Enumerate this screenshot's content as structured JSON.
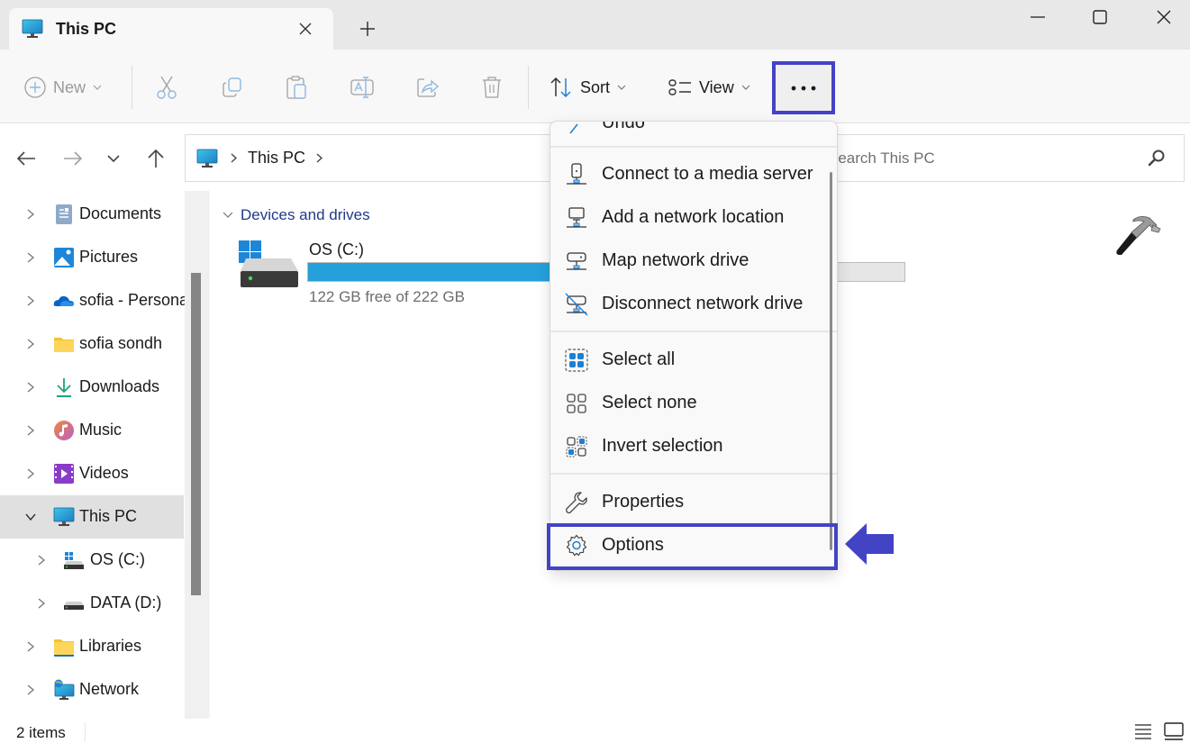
{
  "window": {
    "tab_title": "This PC",
    "controls": {
      "minimize": "minimize",
      "maximize": "maximize",
      "close": "close"
    }
  },
  "toolbar": {
    "new_label": "New",
    "sort_label": "Sort",
    "view_label": "View",
    "more_label": "See more",
    "icons": [
      "cut-icon",
      "copy-icon",
      "paste-icon",
      "rename-icon",
      "share-icon",
      "delete-icon"
    ]
  },
  "nav": {
    "breadcrumb": [
      "This PC"
    ],
    "search_placeholder": "Search This PC"
  },
  "sidebar": {
    "items": [
      {
        "label": "Documents",
        "icon": "documents-icon"
      },
      {
        "label": "Pictures",
        "icon": "pictures-icon"
      },
      {
        "label": "sofia - Persona",
        "icon": "onedrive-icon"
      },
      {
        "label": "sofia sondh",
        "icon": "folder-icon"
      },
      {
        "label": "Downloads",
        "icon": "download-icon"
      },
      {
        "label": "Music",
        "icon": "music-icon"
      },
      {
        "label": "Videos",
        "icon": "videos-icon"
      },
      {
        "label": "This PC",
        "icon": "pc-icon",
        "selected": true,
        "expanded": true
      },
      {
        "label": "OS (C:)",
        "icon": "os-drive-icon",
        "sub": true
      },
      {
        "label": "DATA (D:)",
        "icon": "drive-icon",
        "sub": true
      },
      {
        "label": "Libraries",
        "icon": "libraries-icon"
      },
      {
        "label": "Network",
        "icon": "network-icon"
      }
    ]
  },
  "main": {
    "group_title": "Devices and drives",
    "drives": [
      {
        "name": "OS (C:)",
        "free_text": "122 GB free of 222 GB",
        "used_fraction": 0.45
      }
    ]
  },
  "menu": {
    "partial_item": "Undo",
    "items": [
      {
        "label": "Connect to a media server",
        "icon": "media-server-icon"
      },
      {
        "label": "Add a network location",
        "icon": "network-location-icon"
      },
      {
        "label": "Map network drive",
        "icon": "map-drive-icon"
      },
      {
        "label": "Disconnect network drive",
        "icon": "disconnect-drive-icon"
      },
      {
        "label": "Select all",
        "icon": "select-all-icon"
      },
      {
        "label": "Select none",
        "icon": "select-none-icon"
      },
      {
        "label": "Invert selection",
        "icon": "invert-selection-icon"
      },
      {
        "label": "Properties",
        "icon": "wrench-icon"
      },
      {
        "label": "Options",
        "icon": "gear-icon",
        "highlighted": true
      }
    ]
  },
  "status": {
    "item_count": "2 items"
  },
  "colors": {
    "accent": "#26a0da",
    "annotation": "#4343c6"
  }
}
